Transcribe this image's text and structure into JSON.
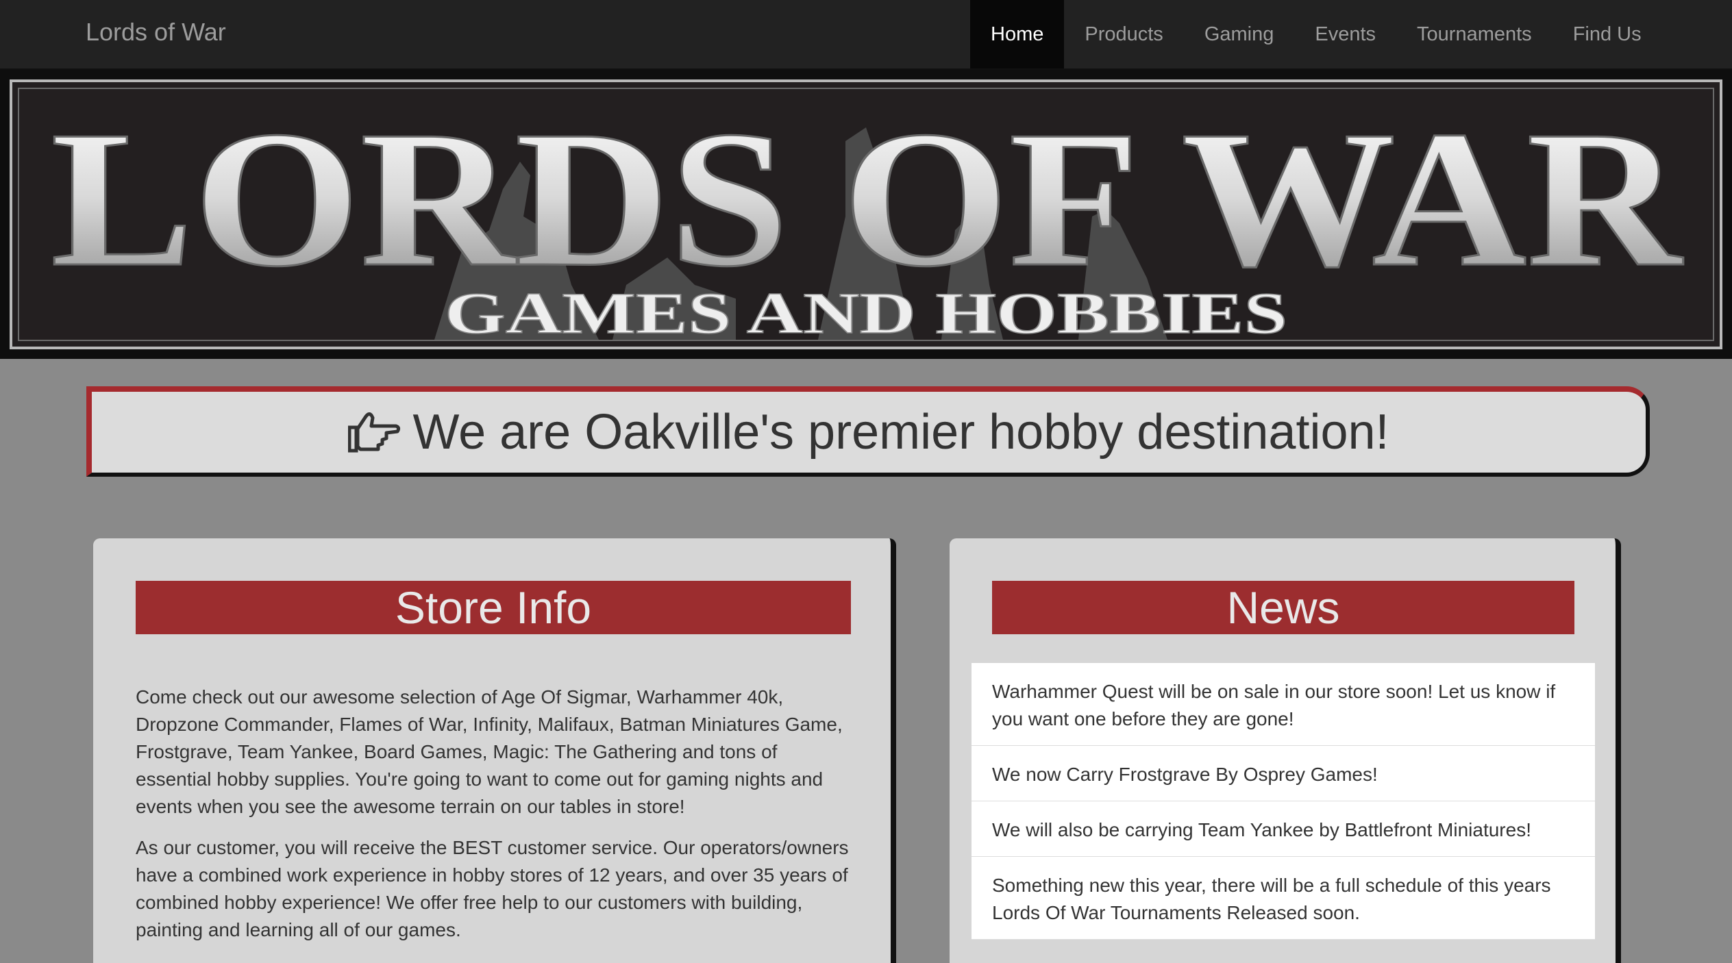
{
  "navbar": {
    "brand": "Lords of War",
    "items": [
      {
        "label": "Home",
        "active": true
      },
      {
        "label": "Products",
        "active": false
      },
      {
        "label": "Gaming",
        "active": false
      },
      {
        "label": "Events",
        "active": false
      },
      {
        "label": "Tournaments",
        "active": false
      },
      {
        "label": "Find Us",
        "active": false
      }
    ]
  },
  "banner": {
    "title": "LORDS OF WAR",
    "subtitle": "GAMES AND HOBBIES"
  },
  "headline": {
    "icon": "hand-pointing-right-icon",
    "text": "We are Oakville's premier hobby destination!"
  },
  "store_info": {
    "title": "Store Info",
    "paragraphs": [
      "Come check out our awesome selection of Age Of Sigmar, Warhammer 40k, Dropzone Commander, Flames of War, Infinity, Malifaux, Batman Miniatures Game, Frostgrave, Team Yankee, Board Games, Magic: The Gathering and tons of essential hobby supplies. You're going to want to come out for gaming nights and events when you see the awesome terrain on our tables in store!",
      "As our customer, you will receive the BEST customer service. Our operators/owners have a combined work experience in hobby stores of 12 years, and over 35 years of combined hobby experience! We offer free help to our customers with building, painting and learning all of our games."
    ]
  },
  "news": {
    "title": "News",
    "items": [
      "Warhammer Quest will be on sale in our store soon! Let us know if you want one before they are gone!",
      "We now Carry Frostgrave By Osprey Games!",
      "We will also be carrying Team Yankee by Battlefront Miniatures!",
      "Something new this year, there will be a full schedule of this years Lords Of War Tournaments Released soon."
    ]
  },
  "colors": {
    "accent_red": "#9c2d2f",
    "navbar_bg": "#222222",
    "page_bg": "#8a8a8a"
  }
}
